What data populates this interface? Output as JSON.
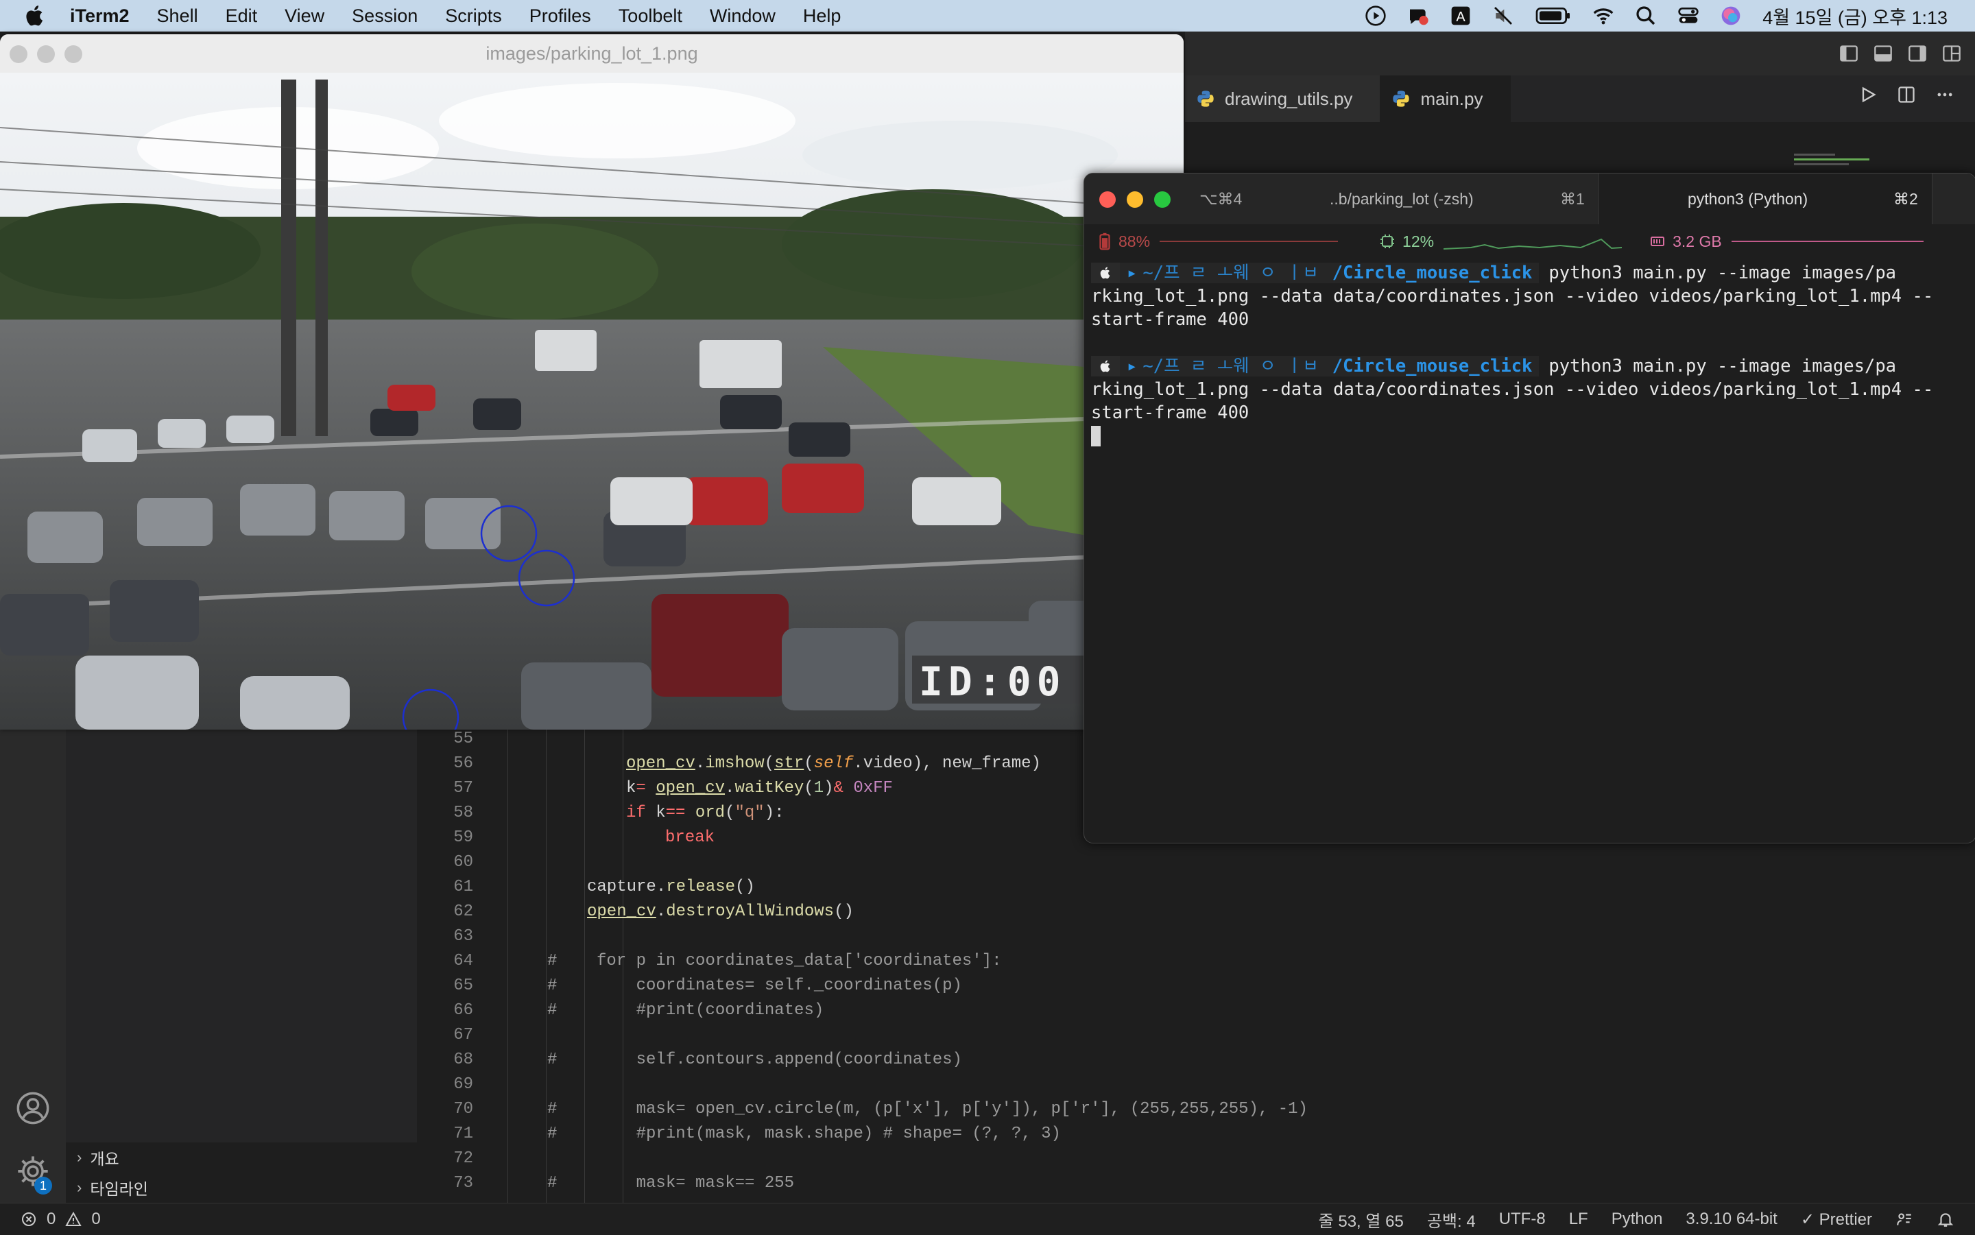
{
  "menubar": {
    "app_name": "iTerm2",
    "items": [
      "Shell",
      "Edit",
      "View",
      "Session",
      "Scripts",
      "Profiles",
      "Toolbelt",
      "Window",
      "Help"
    ],
    "datetime": "4월 15일 (금) 오후 1:13",
    "icons": [
      "play-circle-icon",
      "notification-icon",
      "input-source-icon",
      "mute-icon",
      "battery-icon",
      "wifi-icon",
      "search-icon",
      "control-center-icon",
      "siri-icon"
    ]
  },
  "image_window": {
    "title": "images/parking_lot_1.png",
    "overlay_text": "ID:00"
  },
  "vscode": {
    "tabs": [
      {
        "label": "drawing_utils.py",
        "icon": "python-icon"
      },
      {
        "label": "main.py",
        "icon": "python-icon"
      }
    ],
    "outline": [
      {
        "label": "개요"
      },
      {
        "label": "타임라인"
      }
    ],
    "settings_badge": "1",
    "code_lines": [
      {
        "n": "55"
      },
      {
        "n": "56"
      },
      {
        "n": "57"
      },
      {
        "n": "58"
      },
      {
        "n": "59"
      },
      {
        "n": "60"
      },
      {
        "n": "61"
      },
      {
        "n": "62"
      },
      {
        "n": "63"
      },
      {
        "n": "64"
      },
      {
        "n": "65"
      },
      {
        "n": "66"
      },
      {
        "n": "67"
      },
      {
        "n": "68"
      },
      {
        "n": "69"
      },
      {
        "n": "70"
      },
      {
        "n": "71"
      },
      {
        "n": "72"
      },
      {
        "n": "73"
      }
    ],
    "statusbar": {
      "errors": "0",
      "warnings": "0",
      "position": "줄 53, 열 65",
      "spaces": "공백: 4",
      "encoding": "UTF-8",
      "eol": "LF",
      "language": "Python",
      "interpreter": "3.9.10 64-bit",
      "formatter": "Prettier"
    }
  },
  "terminal": {
    "tabs": [
      {
        "shortcut_left": "⌥⌘4",
        "label": "..b/parking_lot (-zsh)",
        "shortcut_right": "⌘1"
      },
      {
        "label": "python3 (Python)",
        "shortcut_right": "⌘2"
      }
    ],
    "meters": {
      "battery": "88%",
      "cpu": "12%",
      "memory": "3.2 GB"
    },
    "prompt_dir_blur": "~/프 ㄹ ㅗ웨 ㅇ ㅣㅂ",
    "prompt_dir": "/Circle_mouse_click",
    "commands": [
      {
        "line1": "python3 main.py --image images/pa",
        "line2": "rking_lot_1.png --data data/coordinates.json --video videos/parking_lot_1.mp4 --",
        "line3": "start-frame 400"
      },
      {
        "line1": "python3 main.py --image images/pa",
        "line2": "rking_lot_1.png --data data/coordinates.json --video videos/parking_lot_1.mp4 --",
        "line3": "start-frame 400"
      }
    ]
  }
}
